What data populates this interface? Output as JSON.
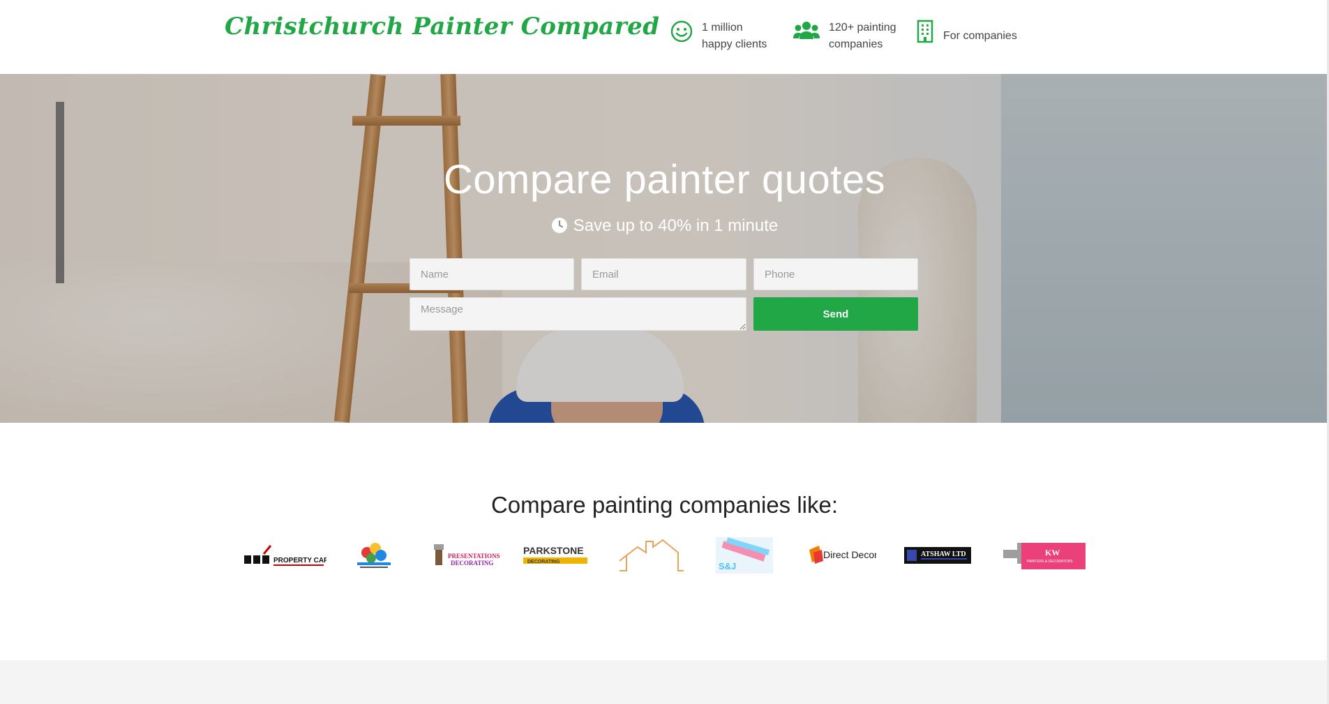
{
  "header": {
    "logo_text": "Christchurch Painter Compared",
    "stats": [
      {
        "icon": "smile-icon",
        "line1": "1 million",
        "line2": "happy clients"
      },
      {
        "icon": "users-icon",
        "line1": "120+ painting",
        "line2": "companies"
      },
      {
        "icon": "building-icon",
        "line1": "For companies"
      }
    ]
  },
  "hero": {
    "title": "Compare painter quotes",
    "subtitle": "Save up to 40% in 1 minute",
    "subtitle_icon": "clock-icon",
    "form": {
      "name_placeholder": "Name",
      "email_placeholder": "Email",
      "phone_placeholder": "Phone",
      "message_placeholder": "Message",
      "send_label": "Send"
    }
  },
  "companies": {
    "title": "Compare painting companies like:",
    "logos": [
      {
        "name": "R D M PROPERTY CARE"
      },
      {
        "name": "colourful-splash-logo"
      },
      {
        "name": "PRESENTATIONS DECORATING"
      },
      {
        "name": "PARKSTONE DECORATING"
      },
      {
        "name": "house-outline-logo"
      },
      {
        "name": "S&J DESIGN"
      },
      {
        "name": "Direct Decor"
      },
      {
        "name": "ATSHAW LTD"
      },
      {
        "name": "KW PAINTERS & DECORATORS"
      }
    ]
  },
  "colors": {
    "brand_green": "#21a746",
    "send_button": "#21a746",
    "footer_band": "#f4f4f4"
  }
}
